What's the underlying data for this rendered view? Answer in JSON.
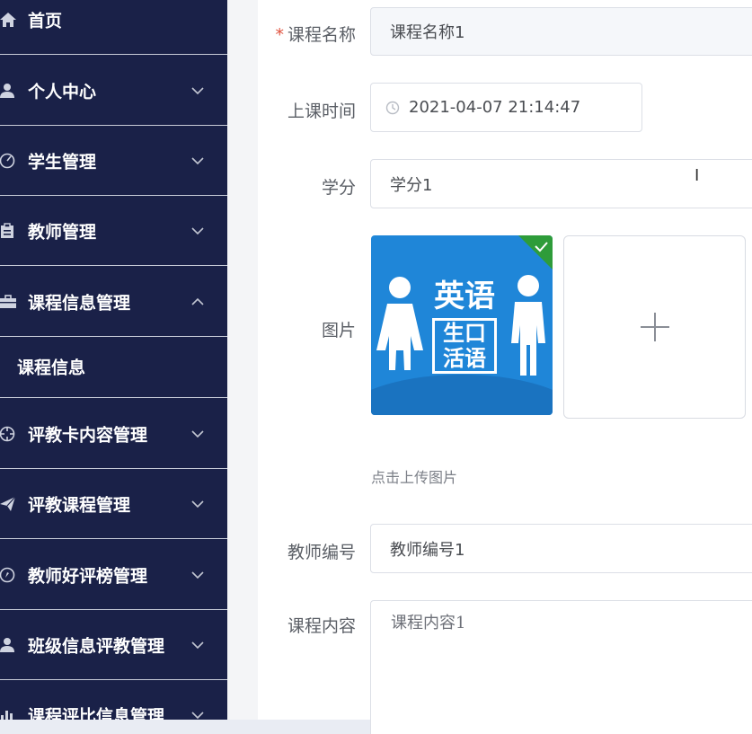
{
  "sidebar": {
    "items": [
      {
        "label": "首页",
        "icon": "home-icon"
      },
      {
        "label": "个人中心",
        "icon": "user-icon"
      },
      {
        "label": "学生管理",
        "icon": "gauge-icon"
      },
      {
        "label": "教师管理",
        "icon": "clipboard-icon"
      },
      {
        "label": "课程信息管理",
        "icon": "briefcase-icon"
      },
      {
        "label": "评教卡内容管理",
        "icon": "crosshair-icon"
      },
      {
        "label": "评教课程管理",
        "icon": "paper-plane-icon"
      },
      {
        "label": "教师好评榜管理",
        "icon": "compass-icon"
      },
      {
        "label": "班级信息评教管理",
        "icon": "user-icon"
      },
      {
        "label": "课程评比信息管理",
        "icon": "bar-chart-icon"
      }
    ],
    "sub_item": {
      "label": "课程信息"
    }
  },
  "form": {
    "course_name": {
      "label": "课程名称",
      "required_mark": "*",
      "value": "课程名称1"
    },
    "class_time": {
      "label": "上课时间",
      "value": "2021-04-07 21:14:47"
    },
    "credit": {
      "label": "学分",
      "value": "学分1"
    },
    "image": {
      "label": "图片",
      "hint": "点击上传图片",
      "thumb_text_line1": "英语",
      "thumb_text_line2": "生口",
      "thumb_text_line3": "活语"
    },
    "teacher_id": {
      "label": "教师编号",
      "value": "教师编号1"
    },
    "content": {
      "label": "课程内容",
      "value": "课程内容1"
    }
  },
  "colors": {
    "sidebar_bg": "#1a2148",
    "accent_required": "#e0523e",
    "thumb_blue": "#1f86d8",
    "thumb_check": "#2e9c3a"
  }
}
